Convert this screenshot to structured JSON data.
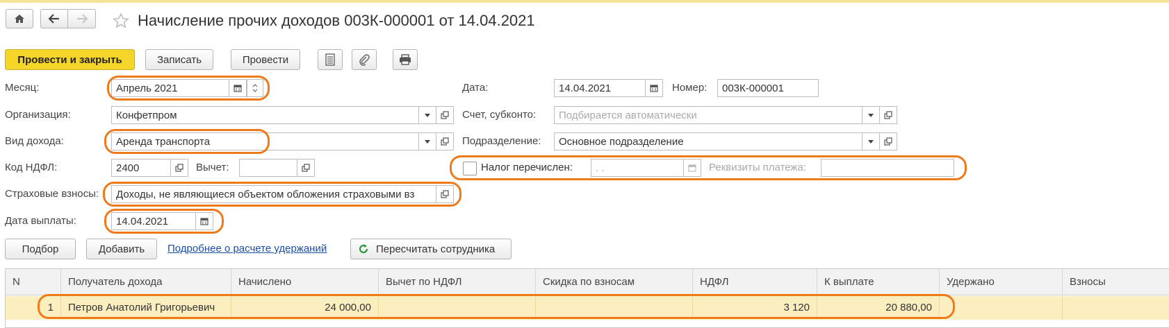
{
  "window": {
    "title": "Начисление прочих доходов 003К-000001 от 14.04.2021",
    "home_icon": "home-icon",
    "back_icon": "arrow-left-icon",
    "forward_icon": "arrow-right-icon",
    "star_icon": "star-icon"
  },
  "toolbar": {
    "post_close": "Провести и закрыть",
    "save": "Записать",
    "post": "Провести",
    "list_icon": "document-list-icon",
    "attach_icon": "paperclip-icon",
    "print_icon": "printer-icon"
  },
  "form": {
    "month_label": "Месяц:",
    "month_value": "Апрель 2021",
    "org_label": "Организация:",
    "org_value": "Конфетпром",
    "income_type_label": "Вид дохода:",
    "income_type_value": "Аренда транспорта",
    "ndfl_code_label": "Код НДФЛ:",
    "ndfl_code_value": "2400",
    "deduction_label": "Вычет:",
    "deduction_value": "",
    "insurance_label": "Страховые взносы:",
    "insurance_value": "Доходы, не являющиеся объектом обложения страховыми вз",
    "pay_date_label": "Дата выплаты:",
    "pay_date_value": "14.04.2021",
    "date_label": "Дата:",
    "date_value": "14.04.2021",
    "number_label": "Номер:",
    "number_value": "003К-000001",
    "account_label": "Счет, субконто:",
    "account_placeholder": "Подбирается автоматически",
    "department_label": "Подразделение:",
    "department_value": "Основное подразделение",
    "tax_paid_label": "Налог перечислен:",
    "tax_paid_date": " .  .",
    "payment_details_label": "Реквизиты платежа:",
    "payment_details_value": ""
  },
  "actions": {
    "pick": "Подбор",
    "add": "Добавить",
    "details_link": "Подробнее о расчете удержаний",
    "recalc": "Пересчитать сотрудника"
  },
  "table": {
    "columns": [
      "N",
      "Получатель дохода",
      "Начислено",
      "Вычет по НДФЛ",
      "Скидка по взносам",
      "НДФЛ",
      "К выплате",
      "Удержано",
      "Взносы"
    ],
    "rows": [
      {
        "n": "1",
        "recipient": "Петров Анатолий Григорьевич",
        "accrued": "24 000,00",
        "ndfl_deduction": "",
        "contrib_discount": "",
        "ndfl": "3 120",
        "to_pay": "20 880,00",
        "withheld": "",
        "contributions": ""
      }
    ]
  },
  "colors": {
    "accent_yellow": "#f6d529",
    "highlight_orange": "#ef7a1a",
    "row_selected": "#fbefbf",
    "link_blue": "#1b4ea8"
  }
}
